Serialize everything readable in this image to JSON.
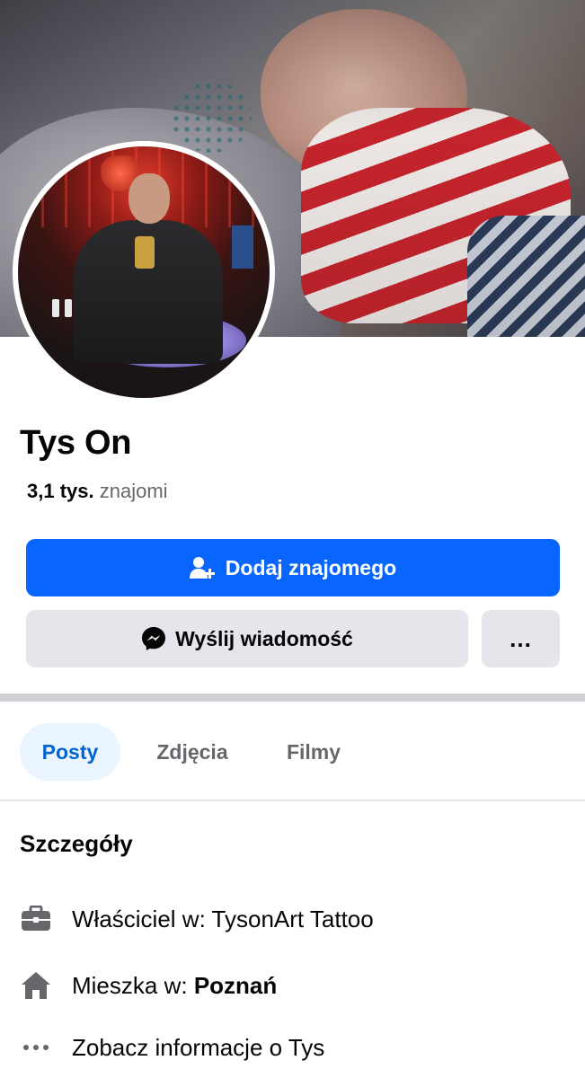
{
  "profile": {
    "name": "Tys On",
    "friends_count": "3,1 tys.",
    "friends_label": "znajomi"
  },
  "actions": {
    "add_friend_label": "Dodaj znajomego",
    "message_label": "Wyślij wiadomość",
    "more_label": "..."
  },
  "tabs": [
    {
      "label": "Posty",
      "active": true
    },
    {
      "label": "Zdjęcia",
      "active": false
    },
    {
      "label": "Filmy",
      "active": false
    }
  ],
  "details": {
    "title": "Szczegóły",
    "work_prefix": "Właściciel w: ",
    "work_place": "TysonArt Tattoo",
    "home_prefix": "Mieszka w: ",
    "home_city": "Poznań",
    "see_about": "Zobacz informacje o Tys"
  },
  "icons": {
    "add_friend": "add-friend-icon",
    "messenger": "messenger-icon",
    "more": "more-dots-icon",
    "work": "briefcase-icon",
    "home": "home-icon",
    "about": "more-dots-icon"
  },
  "colors": {
    "primary": "#0866ff",
    "secondary_button": "#e4e6eb",
    "active_tab_bg": "#ebf5ff",
    "active_tab_text": "#0064d1",
    "muted_text": "#65676b"
  }
}
